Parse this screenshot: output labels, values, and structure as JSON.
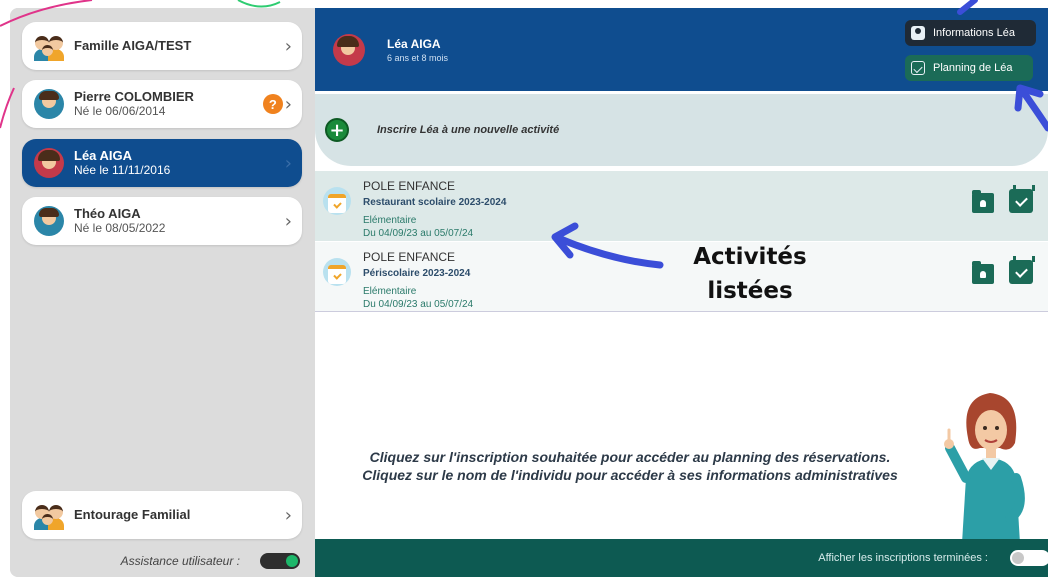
{
  "sidebar": {
    "family": {
      "name": "Famille AIGA/TEST",
      "icon": "family-icon"
    },
    "members": [
      {
        "name": "Pierre COLOMBIER",
        "sub": "Né le 06/06/2014",
        "icon": "child-avatar-icon",
        "badge": "?"
      },
      {
        "name": "Léa AIGA",
        "sub": "Née le 11/11/2016",
        "icon": "girl-avatar-icon",
        "active": true
      },
      {
        "name": "Théo AIGA",
        "sub": "Né le 08/05/2022",
        "icon": "child-avatar-icon"
      }
    ],
    "entourage": {
      "name": "Entourage Familial",
      "icon": "family-icon"
    },
    "assistance_label": "Assistance utilisateur :",
    "assistance_on": true,
    "chevron": "›"
  },
  "header": {
    "name": "Léa AIGA",
    "age": "6 ans et 8 mois",
    "info_button": "Informations Léa",
    "planning_button": "Planning de Léa"
  },
  "new_activity": {
    "plus": "+",
    "label": "Inscrire Léa à une nouvelle activité"
  },
  "activities": [
    {
      "pole": "POLE ENFANCE",
      "title": "Restaurant scolaire 2023-2024",
      "level": "Elémentaire",
      "dates": "Du 04/09/23 au 05/07/24"
    },
    {
      "pole": "POLE ENFANCE",
      "title": "Périscolaire 2023-2024",
      "level": "Elémentaire",
      "dates": "Du 04/09/23 au 05/07/24"
    }
  ],
  "annotation": {
    "line1": "Activités",
    "line2": "listées"
  },
  "instructions": {
    "line1": "Cliquez sur l'inscription souhaitée pour accéder au planning des réservations.",
    "line2": "Cliquez sur le nom de l'individu pour accéder à ses informations administratives"
  },
  "footer": {
    "show_finished_label": "Afficher les inscriptions terminées :",
    "show_finished_on": false
  },
  "colors": {
    "header_blue": "#0f4d8f",
    "footer_teal": "#0d5a52",
    "accent_green": "#1b6b57",
    "annotation_arrow": "#3b4ed8",
    "decor_pink": "#e0348a"
  }
}
